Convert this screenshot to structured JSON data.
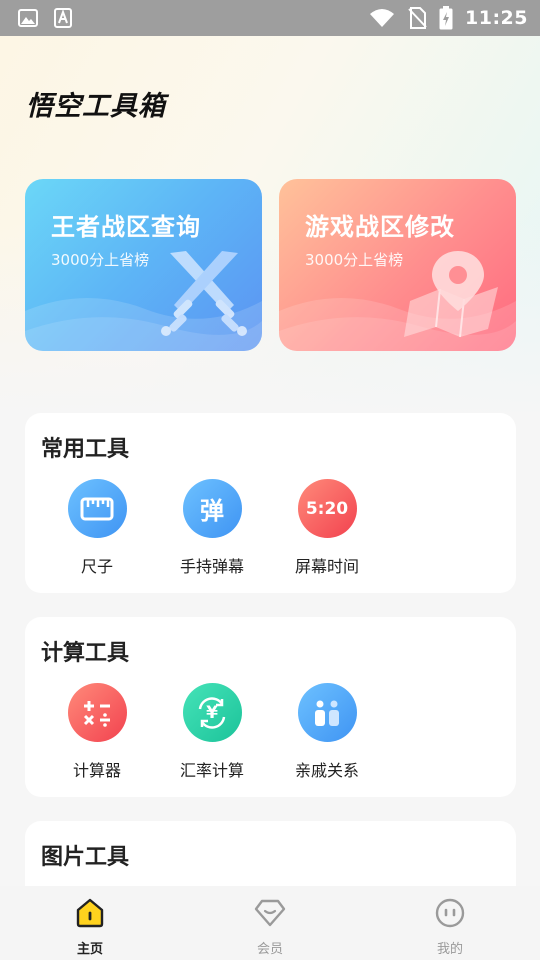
{
  "status_bar": {
    "time": "11:25",
    "icons": [
      "image-icon",
      "text-a-icon",
      "wifi-icon",
      "no-sim-icon",
      "battery-charging-icon"
    ]
  },
  "app": {
    "title": "悟空工具箱"
  },
  "promos": [
    {
      "title": "王者战区查询",
      "subtitle": "3000分上省榜",
      "icon": "crossed-swords-icon",
      "color": "#5bb0f6"
    },
    {
      "title": "游戏战区修改",
      "subtitle": "3000分上省榜",
      "icon": "map-pin-icon",
      "color": "#ff7f86"
    }
  ],
  "sections": [
    {
      "title": "常用工具",
      "tools": [
        {
          "label": "尺子",
          "icon": "ruler-icon",
          "color": "#4aa6f6"
        },
        {
          "label": "手持弹幕",
          "icon": "barrage-icon",
          "glyph": "弹",
          "color": "#4aa6f6"
        },
        {
          "label": "屏幕时间",
          "icon": "clock-text-icon",
          "glyph": "5:20",
          "color": "#fe5c63"
        }
      ]
    },
    {
      "title": "计算工具",
      "tools": [
        {
          "label": "计算器",
          "icon": "calculator-icon",
          "color": "#fe5c63"
        },
        {
          "label": "汇率计算",
          "icon": "currency-exchange-icon",
          "glyph": "¥",
          "color": "#2ad3a9"
        },
        {
          "label": "亲戚关系",
          "icon": "relatives-icon",
          "color": "#4aa6f6"
        }
      ]
    },
    {
      "title": "图片工具",
      "tools": []
    }
  ],
  "tabbar": {
    "tabs": [
      {
        "label": "主页",
        "icon": "home-icon",
        "active": true
      },
      {
        "label": "会员",
        "icon": "diamond-icon",
        "active": false
      },
      {
        "label": "我的",
        "icon": "profile-face-icon",
        "active": false
      }
    ]
  }
}
